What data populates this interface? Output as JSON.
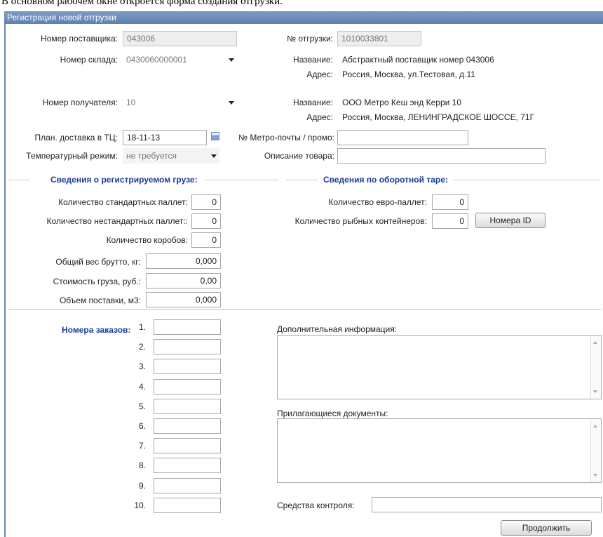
{
  "caption": "В основном рабочем окне откроется форма создания отгрузки.",
  "window": {
    "title": "Регистрация новой отгрузки"
  },
  "supplier": {
    "label": "Номер поставщика:",
    "value": "043006"
  },
  "warehouse": {
    "label": "Номер склада:",
    "value": "0430060000001"
  },
  "shipment": {
    "label": "№ отгрузки:",
    "value": "1010033801"
  },
  "supplier_info": {
    "name_label": "Название:",
    "name": "Абстрактный поставщик номер 043006",
    "address_label": "Адрес:",
    "address": "Россия, Москва, ул.Тестовая, д.11"
  },
  "recipient": {
    "label": "Номер получателя:",
    "value": "10"
  },
  "recipient_info": {
    "name_label": "Название:",
    "name": "ООО Метро Кеш энд Керри 10",
    "address_label": "Адрес:",
    "address": "Россия, Москва, ЛЕНИНГРАДСКОЕ ШОССЕ, 71Г"
  },
  "delivery": {
    "label": "План. доставка в ТЦ:",
    "value": "18-11-13"
  },
  "metro_mail": {
    "label": "№ Метро-почты / промо:",
    "value": ""
  },
  "temperature": {
    "label": "Температурный режим:",
    "value": "не требуется"
  },
  "description": {
    "label": "Описание товара:",
    "value": ""
  },
  "cargo": {
    "title": "Сведения о регистрируемом грузе:",
    "std_pallets_label": "Количество стандартных паллет:",
    "std_pallets": "0",
    "nonstd_pallets_label": "Количество нестандартных паллет::",
    "nonstd_pallets": "0",
    "boxes_label": "Количество коробов:",
    "boxes": "0",
    "weight_label": "Общий вес брутто, кг:",
    "weight": "0,000",
    "cost_label": "Стоимость груза, руб.:",
    "cost": "0,00",
    "volume_label": "Объем поставки, м3:",
    "volume": "0,000"
  },
  "tare": {
    "title": "Сведения по оборотной таре:",
    "euro_label": "Количество евро-паллет:",
    "euro": "0",
    "fish_label": "Количество рыбных контейнеров:",
    "fish": "0",
    "ids_button": "Номера ID"
  },
  "orders": {
    "title": "Номера заказов:",
    "numbers": [
      "1.",
      "2.",
      "3.",
      "4.",
      "5.",
      "6.",
      "7.",
      "8.",
      "9.",
      "10."
    ]
  },
  "extra_info_label": "Дополнительная информация:",
  "documents_label": "Прилагающиеся документы:",
  "control_label": "Средства контроля:",
  "continue_button": "Продолжить"
}
